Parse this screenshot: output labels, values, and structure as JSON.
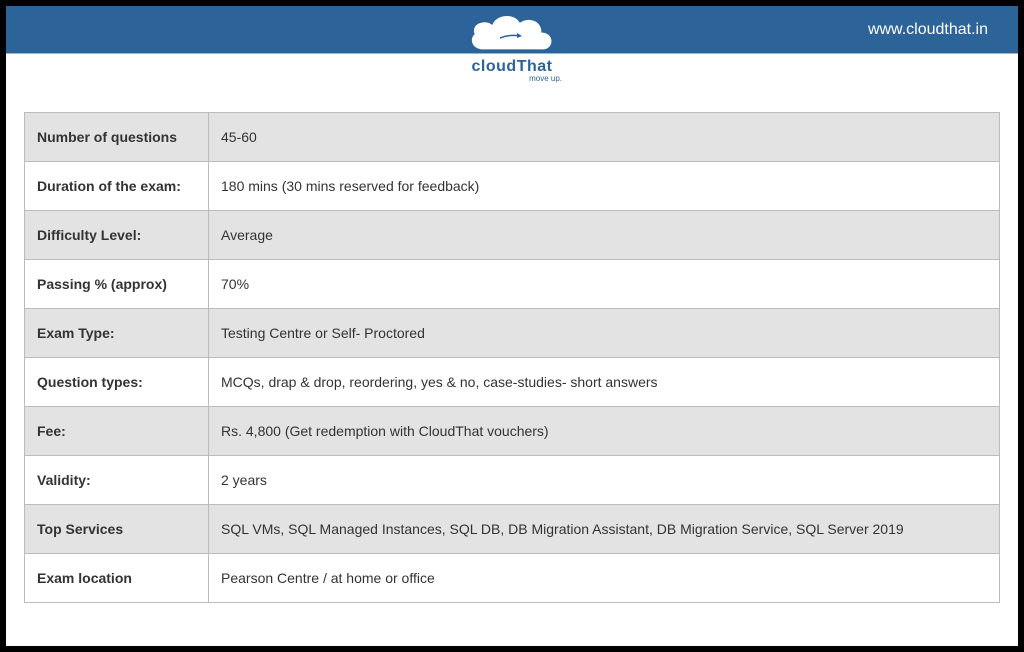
{
  "header": {
    "website": "www.cloudthat.in",
    "brand_name": "cloudThat",
    "tagline": "move up."
  },
  "rows": [
    {
      "label": "Number of questions",
      "value": "45-60"
    },
    {
      "label": "Duration of the exam:",
      "value": "180 mins (30 mins reserved for feedback)"
    },
    {
      "label": "Difficulty Level:",
      "value": "Average"
    },
    {
      "label": "Passing % (approx)",
      "value": "70%"
    },
    {
      "label": "Exam Type:",
      "value": "Testing Centre or Self- Proctored"
    },
    {
      "label": "Question types:",
      "value": "MCQs, drap & drop, reordering, yes & no, case-studies- short answers"
    },
    {
      "label": "Fee:",
      "value": "Rs. 4,800 (Get redemption with CloudThat vouchers)"
    },
    {
      "label": "Validity:",
      "value": "2 years"
    },
    {
      "label": "Top Services",
      "value": "SQL VMs, SQL Managed Instances, SQL DB, DB Migration Assistant, DB Migration Service, SQL Server 2019"
    },
    {
      "label": "Exam location",
      "value": "Pearson Centre / at home or office"
    }
  ]
}
